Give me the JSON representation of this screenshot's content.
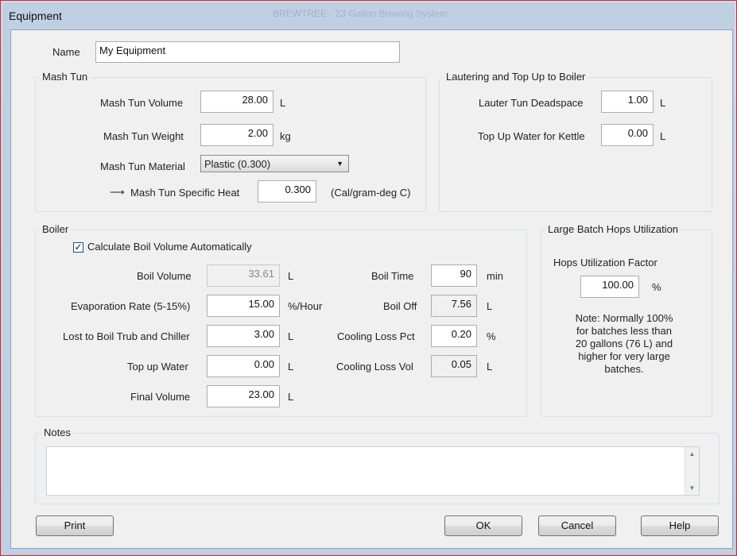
{
  "window": {
    "title": "Equipment",
    "background_text": "BREWTREE - 23 Gallon Brewing System"
  },
  "name": {
    "label": "Name",
    "value": "My Equipment"
  },
  "mash_tun": {
    "group_label": "Mash Tun",
    "volume_label": "Mash Tun Volume",
    "volume_value": "28.00",
    "volume_unit": "L",
    "weight_label": "Mash Tun Weight",
    "weight_value": "2.00",
    "weight_unit": "kg",
    "material_label": "Mash Tun Material",
    "material_value": "Plastic (0.300)",
    "specific_heat_label": "Mash Tun Specific Heat",
    "specific_heat_value": "0.300",
    "specific_heat_unit": "(Cal/gram-deg C)"
  },
  "lautering": {
    "group_label": "Lautering and Top Up to Boiler",
    "deadspace_label": "Lauter Tun Deadspace",
    "deadspace_value": "1.00",
    "deadspace_unit": "L",
    "topup_label": "Top Up Water for Kettle",
    "topup_value": "0.00",
    "topup_unit": "L"
  },
  "boiler": {
    "group_label": "Boiler",
    "auto_label": "Calculate Boil Volume Automatically",
    "boil_volume_label": "Boil Volume",
    "boil_volume_value": "33.61",
    "boil_volume_unit": "L",
    "evap_label": "Evaporation Rate (5-15%)",
    "evap_value": "15.00",
    "evap_unit": "%/Hour",
    "lost_label": "Lost to Boil Trub and Chiller",
    "lost_value": "3.00",
    "lost_unit": "L",
    "topup_label": "Top up Water",
    "topup_value": "0.00",
    "topup_unit": "L",
    "final_label": "Final Volume",
    "final_value": "23.00",
    "final_unit": "L",
    "boil_time_label": "Boil Time",
    "boil_time_value": "90",
    "boil_time_unit": "min",
    "boil_off_label": "Boil Off",
    "boil_off_value": "7.56",
    "boil_off_unit": "L",
    "cool_pct_label": "Cooling Loss Pct",
    "cool_pct_value": "0.20",
    "cool_pct_unit": "%",
    "cool_vol_label": "Cooling Loss Vol",
    "cool_vol_value": "0.05",
    "cool_vol_unit": "L"
  },
  "hops": {
    "group_label": "Large Batch Hops Utilization",
    "factor_label": "Hops Utilization Factor",
    "factor_value": "100.00",
    "factor_unit": "%",
    "note_lines": [
      "Note: Normally 100%",
      "for batches less than",
      "20 gallons (76 L) and",
      "higher for very large",
      "batches."
    ]
  },
  "notes": {
    "group_label": "Notes",
    "value": ""
  },
  "buttons": {
    "print": "Print",
    "ok": "OK",
    "cancel": "Cancel",
    "help": "Help"
  },
  "glyphs": {
    "arrow": "⟶",
    "check": "✓",
    "caret": "▼",
    "scroll_up": "▲",
    "scroll_down": "▼"
  }
}
